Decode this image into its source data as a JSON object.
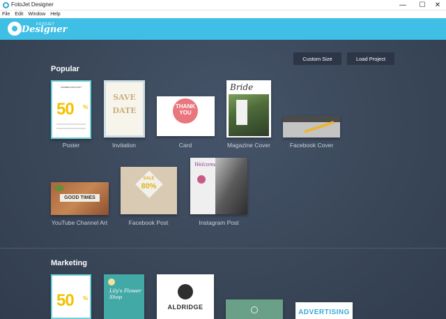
{
  "window": {
    "title": "FotoJet Designer",
    "controls": {
      "minimize": "—",
      "maximize": "☐",
      "close": "✕"
    }
  },
  "menu": {
    "items": [
      "File",
      "Edit",
      "Window",
      "Help"
    ]
  },
  "header": {
    "logo_small": "FOTOJET",
    "logo_big": "Designer"
  },
  "toolbar": {
    "custom_size": "Custom Size",
    "load_project": "Load Project"
  },
  "popular": {
    "title": "Popular",
    "templates": [
      "Poster",
      "Invitation",
      "Card",
      "Magazine Cover",
      "Facebook Cover",
      "YouTube Channel Art",
      "Facebook Post",
      "Instagram Post"
    ]
  },
  "marketing": {
    "title": "Marketing"
  },
  "thumbnails": {
    "poster": {
      "top": "SUMMER DISCOUNT",
      "big": "50",
      "pct": "%"
    },
    "invitation": {
      "line1": "SAVE",
      "line2": "DATE"
    },
    "card": {
      "text": "THANK YOU"
    },
    "magazine": {
      "title": "Bride"
    },
    "youtube": {
      "text": "GOOD TIMES"
    },
    "fbpost": {
      "sale": "SALE",
      "amount": "80%"
    },
    "instagram": {
      "welcome": "Welcome"
    },
    "marketing_poster": {
      "big": "50",
      "pct": "%"
    },
    "marketing_flower": {
      "text": "Lily's Flower Shop"
    },
    "marketing_aldridge": {
      "text": "ALDRIDGE"
    },
    "marketing_adv": {
      "text": "ADVERTISING"
    }
  },
  "colors": {
    "header": "#3fbfe6",
    "background": "#3c4a5e",
    "button": "#2c3647"
  }
}
